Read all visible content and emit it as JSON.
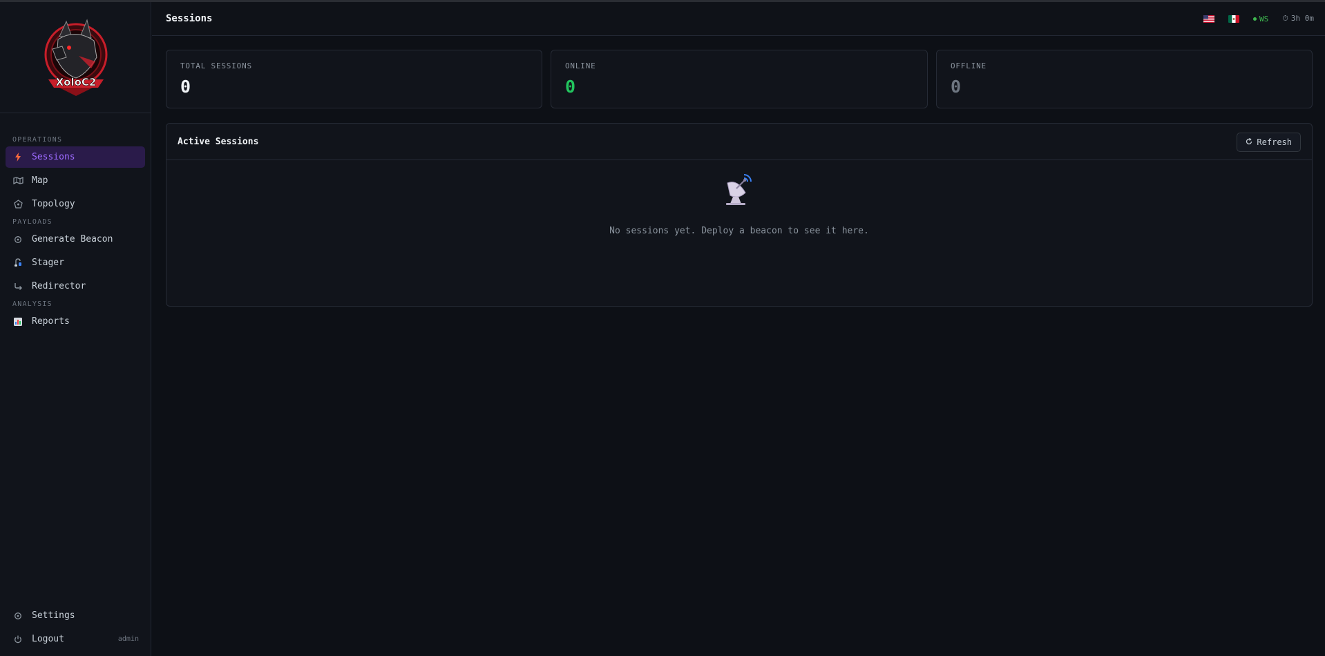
{
  "header": {
    "title": "Sessions",
    "ws_label": "WS",
    "uptime": "3h 0m"
  },
  "logo": {
    "text": "XoloC2"
  },
  "sidebar": {
    "sections": [
      {
        "label": "OPERATIONS"
      },
      {
        "label": "PAYLOADS"
      },
      {
        "label": "ANALYSIS"
      }
    ],
    "items": [
      {
        "label": "Sessions",
        "icon": "lightning-icon",
        "active": true
      },
      {
        "label": "Map",
        "icon": "map-icon"
      },
      {
        "label": "Topology",
        "icon": "topology-icon"
      },
      {
        "label": "Generate Beacon",
        "icon": "gear-icon"
      },
      {
        "label": "Stager",
        "icon": "stager-icon"
      },
      {
        "label": "Redirector",
        "icon": "redirect-arrow-icon"
      },
      {
        "label": "Reports",
        "icon": "bar-chart-icon"
      }
    ],
    "bottom": {
      "settings_label": "Settings",
      "logout_label": "Logout",
      "user": "admin"
    }
  },
  "stats": [
    {
      "label": "TOTAL SESSIONS",
      "value": "0"
    },
    {
      "label": "ONLINE",
      "value": "0",
      "color": "#22c55e"
    },
    {
      "label": "OFFLINE",
      "value": "0",
      "color": "#6e7681"
    }
  ],
  "panel": {
    "title": "Active Sessions",
    "refresh_label": "Refresh",
    "empty_text": "No sessions yet. Deploy a beacon to see it here."
  },
  "colors": {
    "accent": "#9d6bff",
    "active_bg": "#2a1b4a",
    "online": "#22c55e",
    "background": "#0d1016"
  }
}
